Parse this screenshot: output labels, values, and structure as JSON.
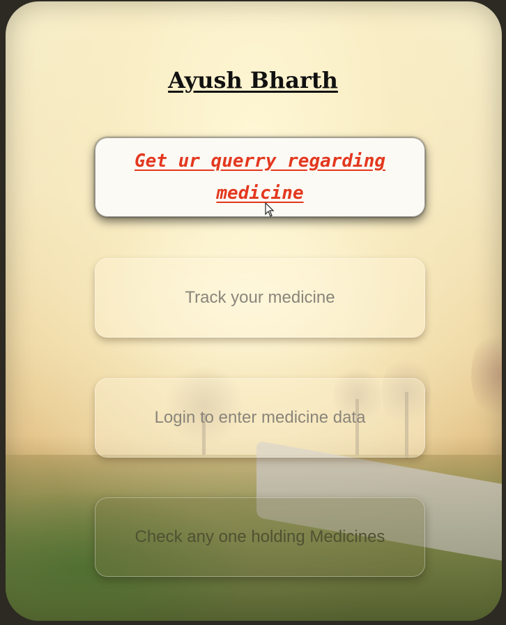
{
  "header": {
    "title": "Ayush Bharth"
  },
  "menu": {
    "items": [
      {
        "label": "Get ur querry regarding medicine",
        "state": "hover"
      },
      {
        "label": "Track your medicine"
      },
      {
        "label": "Login to enter medicine data"
      },
      {
        "label": "Check any one holding Medicines"
      }
    ]
  },
  "colors": {
    "active_text": "#e3381f",
    "muted_text": "#8a857a",
    "title_text": "#111111"
  },
  "icons": {
    "pointer": "mouse-pointer-icon"
  }
}
